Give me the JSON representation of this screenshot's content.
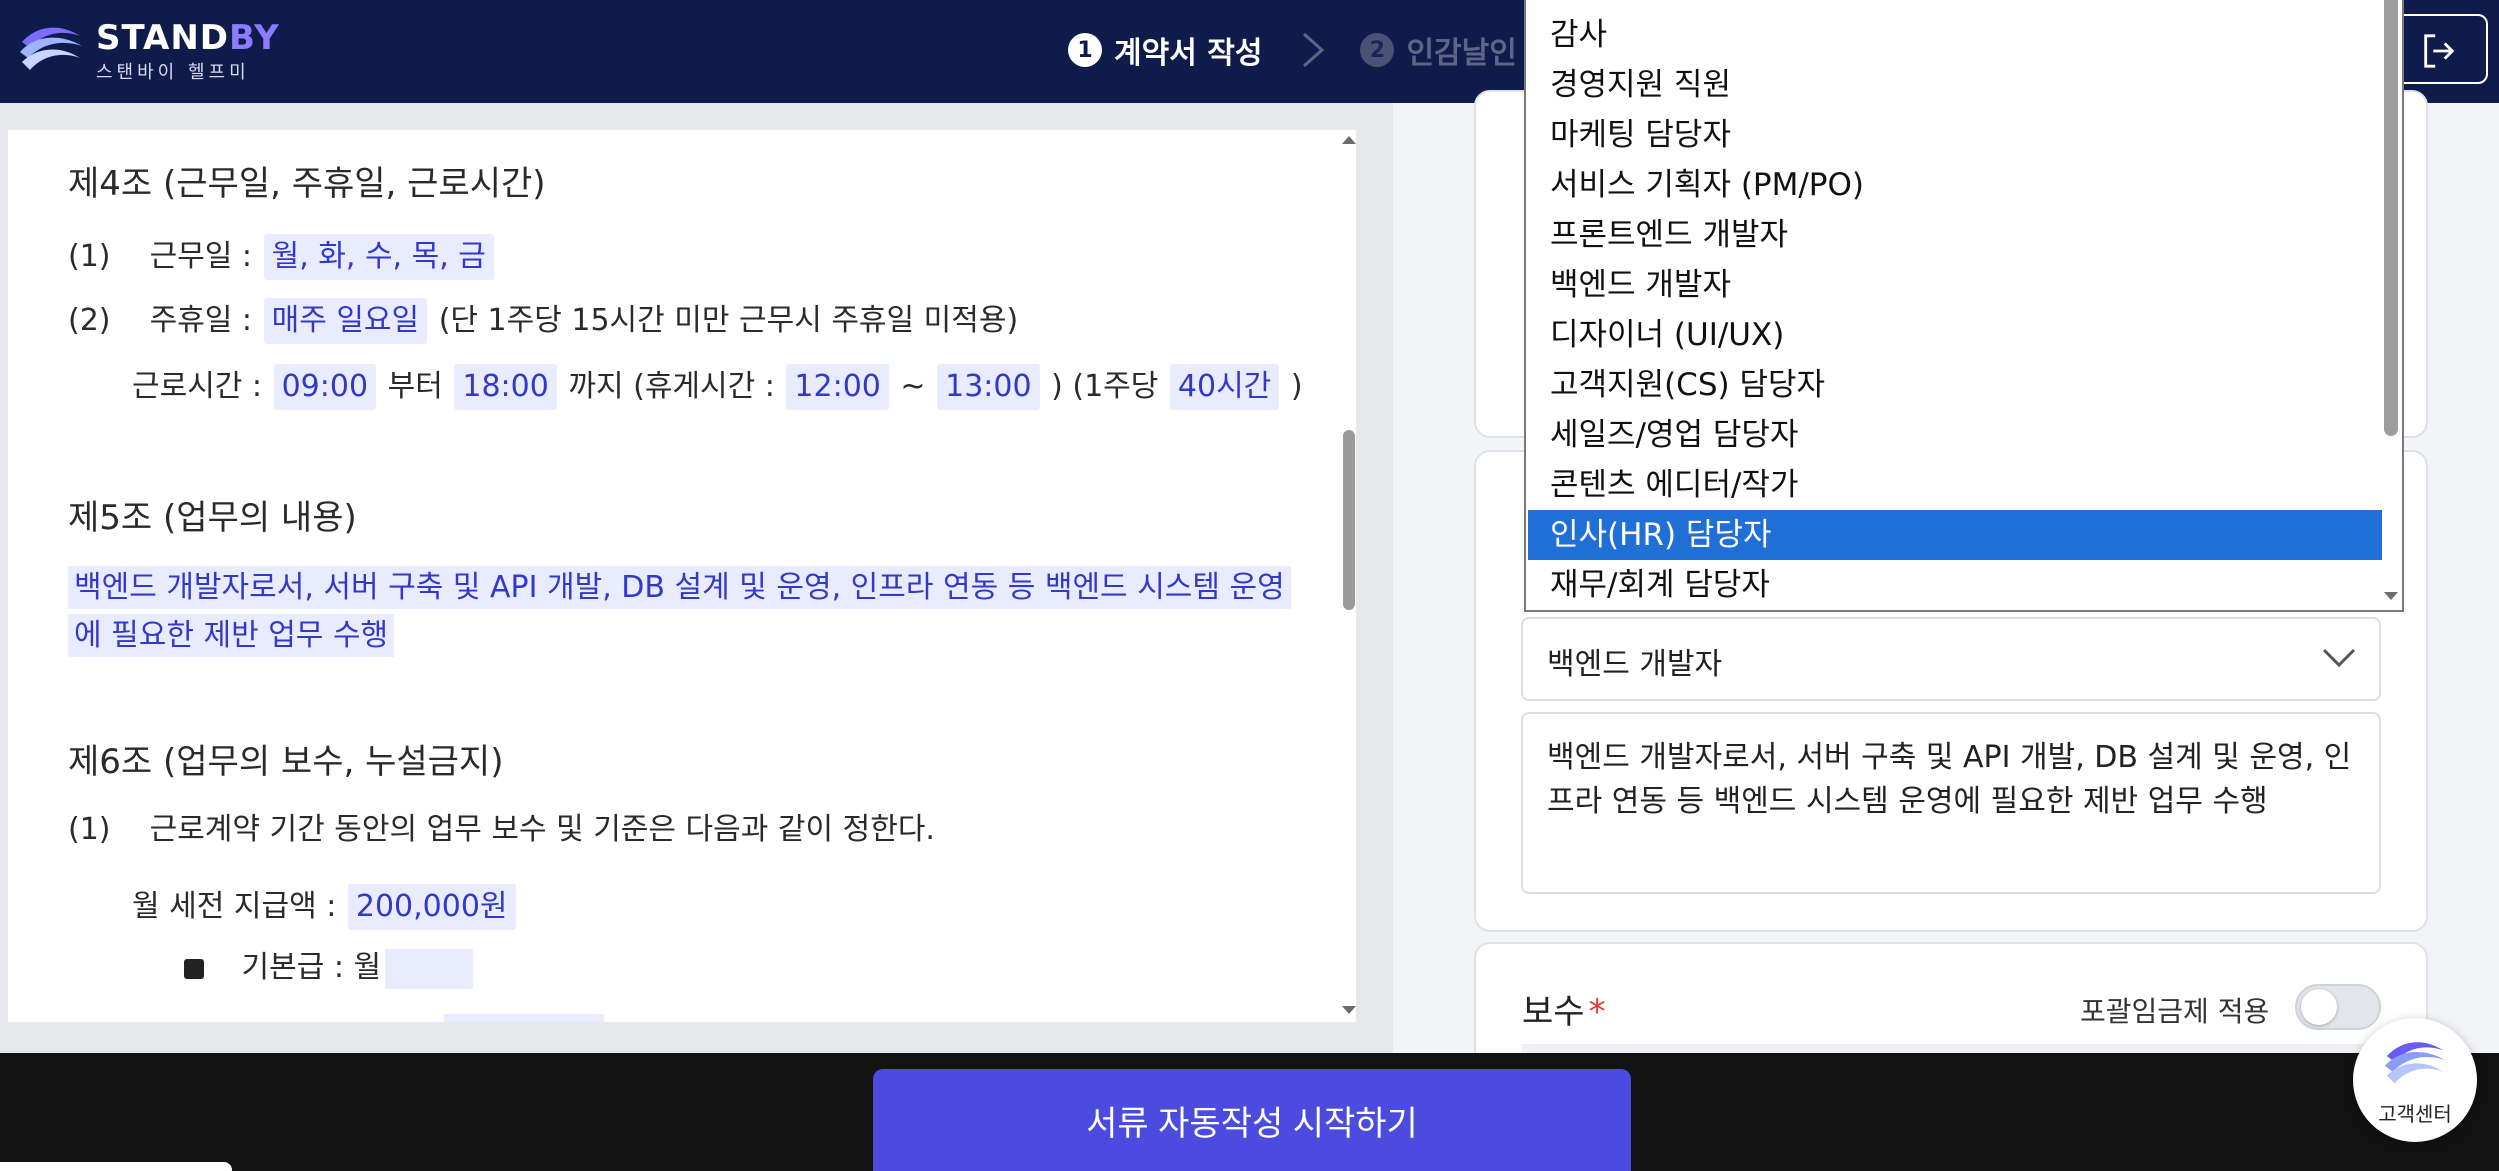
{
  "header": {
    "brand_main": "STAND",
    "brand_accent": "BY",
    "brand_sub": "스탠바이 헬프미",
    "steps": [
      {
        "num": "1",
        "label": "계약서 작성",
        "state": "active"
      },
      {
        "num": "2",
        "label": "인감날인",
        "state": "inactive"
      }
    ],
    "logout_icon": "logout-icon"
  },
  "document": {
    "art4": {
      "title": "제4조 (근무일, 주휴일, 근로시간)",
      "workdays_num": "(1)",
      "workdays_label": "근무일 :",
      "workdays_value": "월, 화, 수, 목, 금",
      "holiday_num": "(2)",
      "holiday_label": "주휴일 :",
      "holiday_value": "매주 일요일",
      "holiday_note": "(단 1주당 15시간 미만 근무시 주휴일 미적용)",
      "hours_label": "근로시간 :",
      "hours_start": "09:00",
      "hours_from": "부터",
      "hours_end": "18:00",
      "hours_to_break": "까지 (휴게시간 :",
      "break_start": "12:00",
      "tilde": "~",
      "break_end": "13:00",
      "week_prefix": ") (1주당",
      "week_hours": "40시간",
      "week_suffix": ")"
    },
    "art5": {
      "title": "제5조 (업무의 내용)",
      "duty": "백엔드 개발자로서, 서버 구축 및 API 개발, DB 설계 및 운영, 인프라 연동 등 백엔드 시스템 운영에 필요한 제반 업무 수행"
    },
    "art6": {
      "title": "제6조 (업무의 보수, 누설금지)",
      "item1_num": "(1)",
      "item1_text": "근로계약 기간 동안의 업무 보수 및 기준은 다음과 같이 정한다.",
      "monthly_label": "월 세전 지급액 :",
      "monthly_value": "200,000원",
      "base_label": "기본급 : 월",
      "base_value": ""
    }
  },
  "right": {
    "dropdown_options": [
      "감사",
      "경영지원 직원",
      "마케팅 담당자",
      "서비스 기획자 (PM/PO)",
      "프론트엔드 개발자",
      "백엔드 개발자",
      "디자이너 (UI/UX)",
      "고객지원(CS) 담당자",
      "세일즈/영업 담당자",
      "콘텐츠 에디터/작가",
      "인사(HR) 담당자",
      "재무/회계 담당자"
    ],
    "dropdown_highlighted": "인사(HR) 담당자",
    "select_value": "백엔드 개발자",
    "textarea_value": "백엔드 개발자로서, 서버 구축 및 API 개발, DB 설계 및 운영, 인프라 연동 등 백엔드 시스템 운영에 필요한 제반 업무 수행",
    "pay_label": "보수",
    "pay_required_mark": "*",
    "toggle_label": "포괄임금제 적용",
    "toggle_on": false
  },
  "footer": {
    "cta_label": "서류 자동작성 시작하기",
    "help_label": "고객센터"
  },
  "colors": {
    "header_bg": "#0f1b4a",
    "accent": "#4c4be0",
    "highlight_bg": "#e9ecff",
    "highlight_text": "#3238c8",
    "selected_option": "#1f6fd6"
  }
}
